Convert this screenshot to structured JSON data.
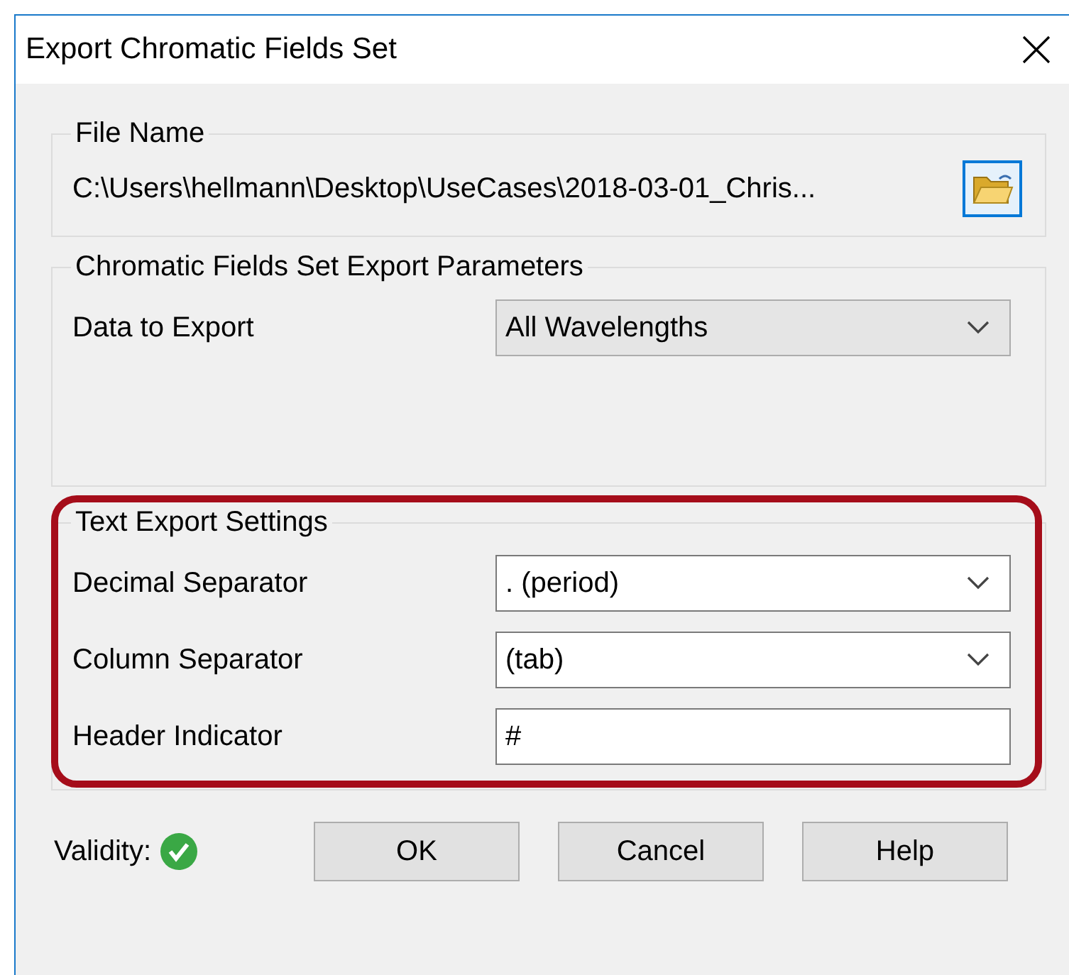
{
  "window": {
    "title": "Export Chromatic Fields Set"
  },
  "file_name": {
    "label": "File Name",
    "path": "C:\\Users\\hellmann\\Desktop\\UseCases\\2018-03-01_Chris..."
  },
  "groups": [
    {
      "title": "Chromatic Fields Set Export Parameters",
      "highlighted": false,
      "rows": [
        {
          "label": "Data to Export",
          "kind": "select",
          "value": "All Wavelengths"
        }
      ]
    },
    {
      "title": "Text Export Settings",
      "highlighted": true,
      "rows": [
        {
          "label": "Decimal Separator",
          "kind": "combo",
          "value": ". (period)"
        },
        {
          "label": "Column Separator",
          "kind": "combo",
          "value": "(tab)"
        },
        {
          "label": "Header Indicator",
          "kind": "text",
          "value": "#"
        }
      ]
    }
  ],
  "validity": {
    "label": "Validity:",
    "valid": true
  },
  "buttons": [
    "OK",
    "Cancel",
    "Help"
  ]
}
